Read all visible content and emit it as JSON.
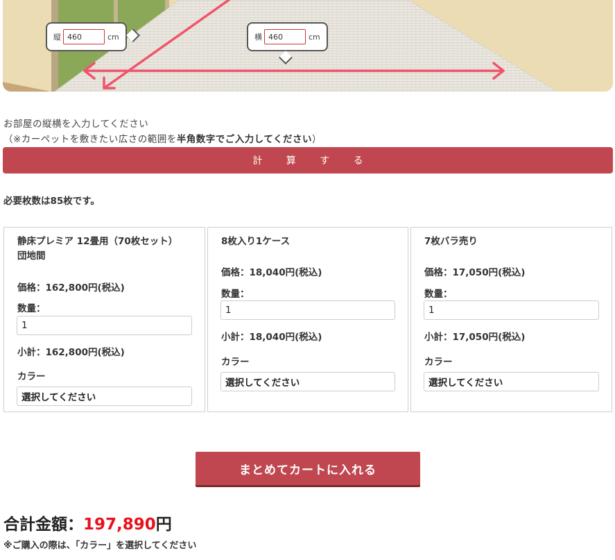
{
  "room": {
    "length_label": "縦",
    "length_value": "460",
    "width_label": "横",
    "width_value": "460",
    "unit": "cm"
  },
  "instructions": {
    "line1": "お部屋の縦横を入力してください",
    "line2_prefix": "（※カーペットを敷きたい広さの範囲を",
    "line2_bold": "半角数字でご入力してください",
    "line2_suffix": "）"
  },
  "calc_button": "計 算 す る",
  "result_text": "必要枚数は85枚です。",
  "products": [
    {
      "name_line1": "静床プレミア 12畳用（70枚セット）",
      "name_line2": "団地間",
      "price": "価格：162,800円(税込)",
      "qty_label": "数量：",
      "qty_value": "1",
      "subtotal": "小計：162,800円(税込)",
      "color_label": "カラー",
      "color_select": "選択してください"
    },
    {
      "name_line1": "8枚入り1ケース",
      "name_line2": "",
      "price": "価格：18,040円(税込)",
      "qty_label": "数量：",
      "qty_value": "1",
      "subtotal": "小計：18,040円(税込)",
      "color_label": "カラー",
      "color_select": "選択してください"
    },
    {
      "name_line1": "7枚バラ売り",
      "name_line2": "",
      "price": "価格：17,050円(税込)",
      "qty_label": "数量：",
      "qty_value": "1",
      "subtotal": "小計：17,050円(税込)",
      "color_label": "カラー",
      "color_select": "選択してください"
    }
  ],
  "cart_button": "まとめてカートに入れる",
  "total": {
    "label": "合計金額：",
    "amount": "197,890",
    "yen": "円"
  },
  "note": "※ご購入の際は、「カラー」を選択してください",
  "colors": {
    "accent": "#c0474f",
    "total_red": "#e8111b",
    "arrow": "#f0546a",
    "wall": "#ecdcb3",
    "carpet": "#e9e6df",
    "window_green": "#8aa858"
  }
}
